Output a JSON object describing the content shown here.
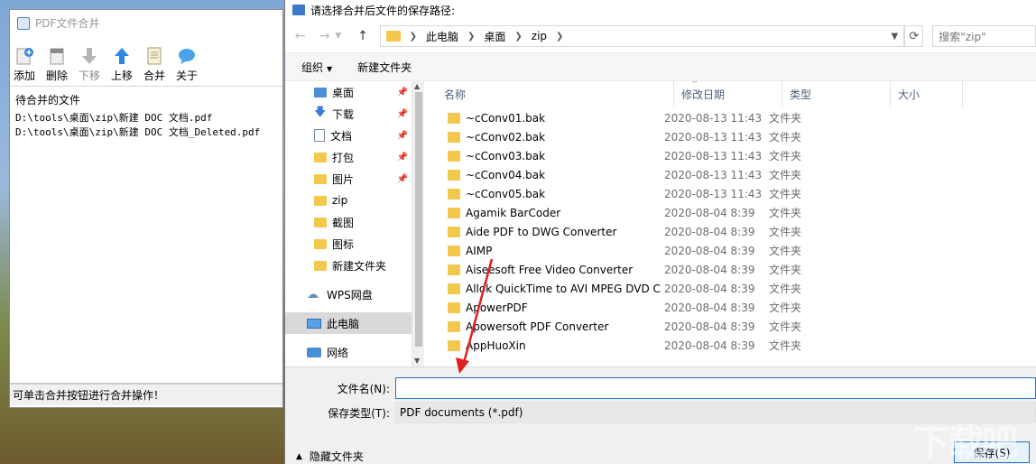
{
  "app": {
    "title": "PDF文件合并",
    "toolbar": [
      {
        "label": "添加",
        "icon": "add-file-icon",
        "enabled": true
      },
      {
        "label": "删除",
        "icon": "delete-file-icon",
        "enabled": true
      },
      {
        "label": "下移",
        "icon": "arrow-down-icon",
        "enabled": false
      },
      {
        "label": "上移",
        "icon": "arrow-up-icon",
        "enabled": true
      },
      {
        "label": "合并",
        "icon": "merge-icon",
        "enabled": true
      },
      {
        "label": "关于",
        "icon": "about-bubble-icon",
        "enabled": true
      }
    ],
    "file_list_header": "待合并的文件",
    "files": [
      "D:\\tools\\桌面\\zip\\新建 DOC 文档.pdf",
      "D:\\tools\\桌面\\zip\\新建 DOC 文档_Deleted.pdf"
    ],
    "status": "可单击合并按钮进行合并操作！"
  },
  "dialog": {
    "title": "请选择合并后文件的保存路径:",
    "breadcrumb": [
      "此电脑",
      "桌面",
      "zip"
    ],
    "search_placeholder": "搜索\"zip\"",
    "commands": {
      "organize": "组织",
      "new_folder": "新建文件夹"
    },
    "nav": [
      {
        "label": "桌面",
        "icon": "desktop-icon",
        "pinned": true,
        "selected": false
      },
      {
        "label": "下载",
        "icon": "download-icon",
        "pinned": true,
        "selected": false
      },
      {
        "label": "文档",
        "icon": "document-icon",
        "pinned": true,
        "selected": false
      },
      {
        "label": "打包",
        "icon": "folder-icon",
        "pinned": true,
        "selected": false
      },
      {
        "label": "图片",
        "icon": "folder-icon",
        "pinned": true,
        "selected": false
      },
      {
        "label": "zip",
        "icon": "folder-icon",
        "pinned": false,
        "selected": false
      },
      {
        "label": "截图",
        "icon": "folder-icon",
        "pinned": false,
        "selected": false
      },
      {
        "label": "图标",
        "icon": "folder-icon",
        "pinned": false,
        "selected": false
      },
      {
        "label": "新建文件夹",
        "icon": "folder-icon",
        "pinned": false,
        "selected": false
      },
      {
        "label": "WPS网盘",
        "icon": "cloud-icon",
        "pinned": false,
        "selected": false
      },
      {
        "label": "此电脑",
        "icon": "computer-icon",
        "pinned": false,
        "selected": true
      },
      {
        "label": "网络",
        "icon": "network-icon",
        "pinned": false,
        "selected": false
      }
    ],
    "columns": {
      "name": "名称",
      "date": "修改日期",
      "type": "类型",
      "size": "大小"
    },
    "rows": [
      {
        "name": "~cConv01.bak",
        "date": "2020-08-13 11:43",
        "type": "文件夹"
      },
      {
        "name": "~cConv02.bak",
        "date": "2020-08-13 11:43",
        "type": "文件夹"
      },
      {
        "name": "~cConv03.bak",
        "date": "2020-08-13 11:43",
        "type": "文件夹"
      },
      {
        "name": "~cConv04.bak",
        "date": "2020-08-13 11:43",
        "type": "文件夹"
      },
      {
        "name": "~cConv05.bak",
        "date": "2020-08-13 11:43",
        "type": "文件夹"
      },
      {
        "name": "Agamik BarCoder",
        "date": "2020-08-04 8:39",
        "type": "文件夹"
      },
      {
        "name": "Aide PDF to DWG Converter",
        "date": "2020-08-04 8:39",
        "type": "文件夹"
      },
      {
        "name": "AIMP",
        "date": "2020-08-04 8:39",
        "type": "文件夹"
      },
      {
        "name": "Aiseesoft Free Video Converter",
        "date": "2020-08-04 8:39",
        "type": "文件夹"
      },
      {
        "name": "Allok QuickTime to AVI MPEG DVD C...",
        "date": "2020-08-04 8:39",
        "type": "文件夹"
      },
      {
        "name": "ApowerPDF",
        "date": "2020-08-04 8:39",
        "type": "文件夹"
      },
      {
        "name": "Apowersoft PDF Converter",
        "date": "2020-08-04 8:39",
        "type": "文件夹"
      },
      {
        "name": "AppHuoXin",
        "date": "2020-08-04 8:39",
        "type": "文件夹"
      }
    ],
    "filename_label": "文件名(N):",
    "filename_value": "",
    "filetype_label": "保存类型(T):",
    "filetype_value": "PDF documents (*.pdf)",
    "hide_folders": "隐藏文件夹",
    "save_button": "保存(S)"
  },
  "colors": {
    "accent": "#1f73c9",
    "folder": "#f2c94c",
    "annotation_arrow": "#e02020"
  }
}
